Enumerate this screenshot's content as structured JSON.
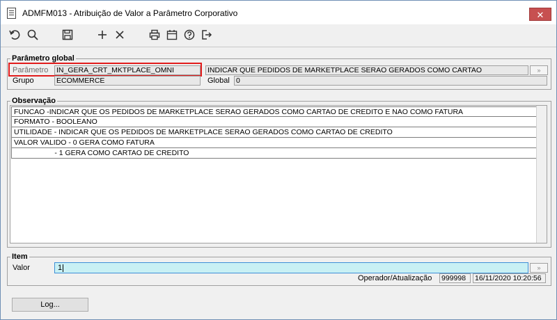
{
  "window": {
    "title": "ADMFM013 - Atribuição de Valor a Parâmetro Corporativo",
    "close_glyph": "✕"
  },
  "toolbar": {
    "icons": [
      "undo-icon",
      "search-icon",
      "save-icon",
      "add-icon",
      "delete-icon",
      "print-icon",
      "calendar-icon",
      "help-icon",
      "exit-icon"
    ]
  },
  "global": {
    "group_title": "Parâmetro global",
    "parametro_label": "Parâmetro",
    "parametro_value": "IN_GERA_CRT_MKTPLACE_OMNI",
    "parametro_desc": "INDICAR QUE PEDIDOS DE MARKETPLACE SERAO GERADOS COMO CARTAO",
    "grupo_label": "Grupo",
    "grupo_value": "ECOMMERCE",
    "global_label": "Global",
    "global_value": "0",
    "lookup_glyph": "»"
  },
  "observacao": {
    "group_title": "Observação",
    "lines": [
      "FUNCAO -INDICAR QUE OS PEDIDOS DE MARKETPLACE SERAO GERADOS COMO CARTAO DE CREDITO E NAO COMO FATURA",
      "FORMATO - BOOLEANO",
      "UTILIDADE - INDICAR QUE OS PEDIDOS DE MARKETPLACE SERAO GERADOS COMO CARTAO DE CREDITO",
      "VALOR VALIDO - 0 GERA COMO FATURA",
      "                    - 1 GERA COMO CARTAO DE CREDITO"
    ]
  },
  "item": {
    "group_title": "Item",
    "valor_label": "Valor",
    "valor_value": "1",
    "operador_label": "Operador/Atualização",
    "operador_value": "999998",
    "atualizacao_value": "16/11/2020 10:20:56"
  },
  "buttons": {
    "log_label": "Log..."
  },
  "colors": {
    "highlight": "#e21c1c",
    "valor_bg": "#c8f0f4",
    "close_bg": "#c75050"
  }
}
